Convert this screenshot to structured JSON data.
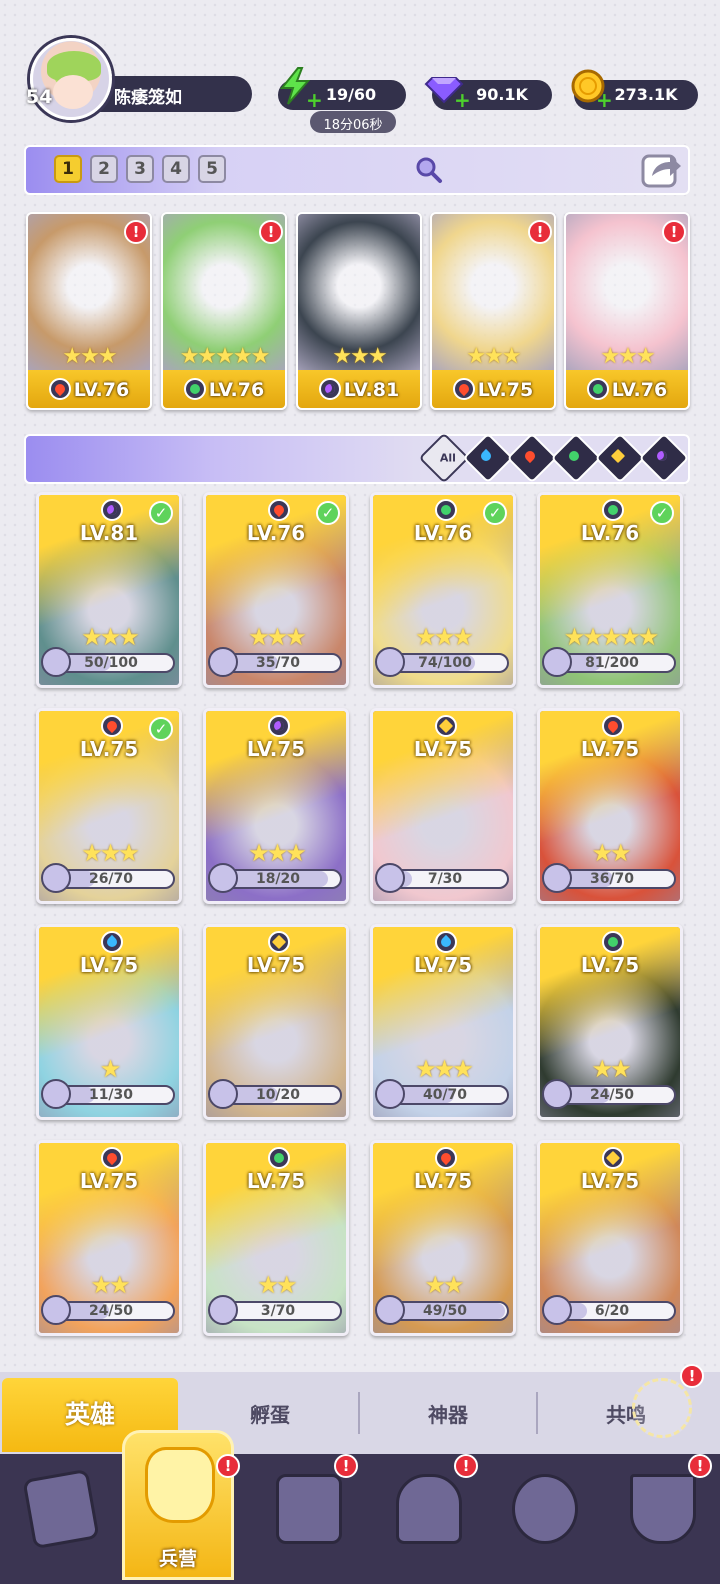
{
  "player": {
    "level": "54",
    "name": "陈痿笼如"
  },
  "resources": {
    "energy": "19/60",
    "energy_timer": "18分06秒",
    "gems": "90.1K",
    "coins": "273.1K"
  },
  "team_tabs": [
    "1",
    "2",
    "3",
    "4",
    "5"
  ],
  "lineup": [
    {
      "level": "LV.76",
      "element": "fire",
      "stars": "★★★",
      "alert": "!",
      "art": "#c79a6a"
    },
    {
      "level": "LV.76",
      "element": "nature",
      "stars": "★★★★★",
      "alert": "!",
      "art": "#8fcf75"
    },
    {
      "level": "LV.81",
      "element": "dark",
      "stars": "★★★",
      "alert": "",
      "art": "#3c4550"
    },
    {
      "level": "LV.75",
      "element": "fire",
      "stars": "★★★",
      "alert": "!",
      "art": "#f0d68d"
    },
    {
      "level": "LV.76",
      "element": "nature",
      "stars": "★★★",
      "alert": "!",
      "art": "#f5c3cf"
    }
  ],
  "filters": {
    "all_label": "All",
    "elements": [
      "water",
      "fire",
      "nature",
      "light",
      "dark"
    ]
  },
  "heroes": [
    {
      "level": "LV.81",
      "element": "dark",
      "owned": true,
      "stars": "★★★",
      "shards": "50/100",
      "progress": 0.5,
      "art": "#5f8f8d"
    },
    {
      "level": "LV.76",
      "element": "fire",
      "owned": true,
      "stars": "★★★",
      "shards": "35/70",
      "progress": 0.5,
      "art": "#c9866a"
    },
    {
      "level": "LV.76",
      "element": "nature",
      "owned": true,
      "stars": "★★★",
      "shards": "74/100",
      "progress": 0.74,
      "art": "#f0dc8a"
    },
    {
      "level": "LV.76",
      "element": "nature",
      "owned": true,
      "stars": "★★★★★",
      "shards": "81/200",
      "progress": 0.405,
      "art": "#8fc476"
    },
    {
      "level": "LV.75",
      "element": "fire",
      "owned": true,
      "stars": "★★★",
      "shards": "26/70",
      "progress": 0.371,
      "art": "#e4d29a"
    },
    {
      "level": "LV.75",
      "element": "dark",
      "owned": false,
      "stars": "★★★",
      "shards": "18/20",
      "progress": 0.9,
      "art": "#8c6fc7"
    },
    {
      "level": "LV.75",
      "element": "light",
      "owned": false,
      "stars": "",
      "shards": "7/30",
      "progress": 0.233,
      "art": "#f1c8cf"
    },
    {
      "level": "LV.75",
      "element": "fire",
      "owned": false,
      "stars": "★★",
      "shards": "36/70",
      "progress": 0.514,
      "art": "#d9523a"
    },
    {
      "level": "LV.75",
      "element": "water",
      "owned": false,
      "stars": "★",
      "shards": "11/30",
      "progress": 0.367,
      "art": "#8fd3e1"
    },
    {
      "level": "LV.75",
      "element": "light",
      "owned": false,
      "stars": "",
      "shards": "10/20",
      "progress": 0.5,
      "art": "#d1b48c"
    },
    {
      "level": "LV.75",
      "element": "water",
      "owned": false,
      "stars": "★★★",
      "shards": "40/70",
      "progress": 0.571,
      "art": "#c3d2e8"
    },
    {
      "level": "LV.75",
      "element": "nature",
      "owned": false,
      "stars": "★★",
      "shards": "24/50",
      "progress": 0.48,
      "art": "#2f3b30"
    },
    {
      "level": "LV.75",
      "element": "fire",
      "owned": false,
      "stars": "★★",
      "shards": "24/50",
      "progress": 0.48,
      "art": "#f2a35c"
    },
    {
      "level": "LV.75",
      "element": "nature",
      "owned": false,
      "stars": "★★",
      "shards": "3/70",
      "progress": 0.043,
      "art": "#c7e3c5"
    },
    {
      "level": "LV.75",
      "element": "fire",
      "owned": false,
      "stars": "★★",
      "shards": "49/50",
      "progress": 0.98,
      "art": "#d59a52"
    },
    {
      "level": "LV.75",
      "element": "light",
      "owned": false,
      "stars": "",
      "shards": "6/20",
      "progress": 0.3,
      "art": "#d0885a"
    }
  ],
  "sub_tabs": [
    "英雄",
    "孵蛋",
    "神器",
    "共鸣"
  ],
  "bottom_nav": {
    "active_label": "兵营",
    "alert": "!"
  }
}
